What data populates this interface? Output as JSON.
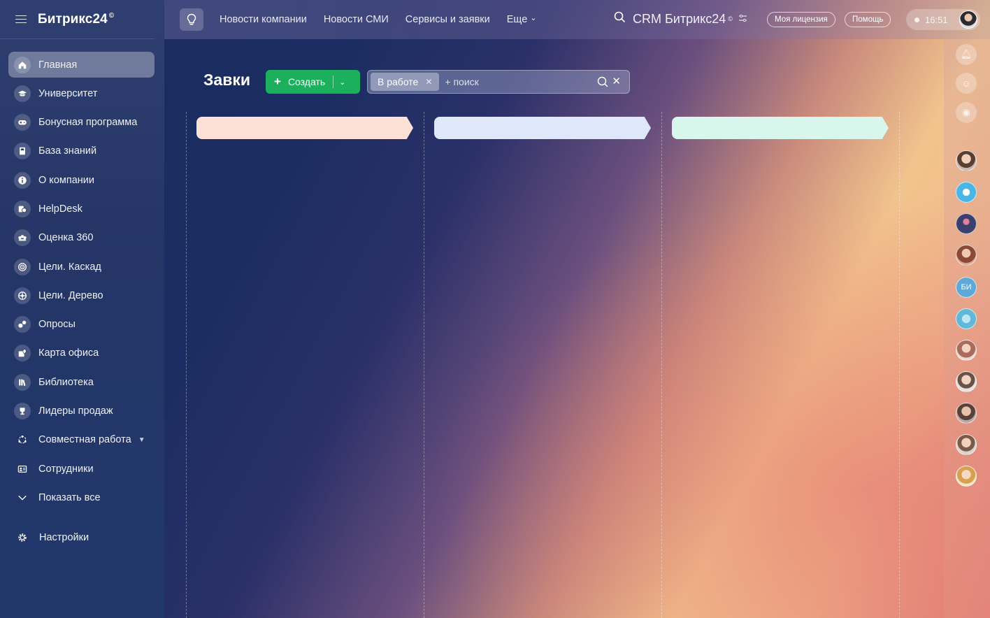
{
  "app": {
    "logo": "Битрикс24",
    "logo_mark": "©"
  },
  "sidebar": {
    "items": [
      {
        "label": "Главная",
        "icon": "home-icon"
      },
      {
        "label": "Университет",
        "icon": "graduation-cap-icon"
      },
      {
        "label": "Бонусная программа",
        "icon": "gamepad-icon"
      },
      {
        "label": "База знаний",
        "icon": "book-icon"
      },
      {
        "label": "О компании",
        "icon": "info-icon"
      },
      {
        "label": "HelpDesk",
        "icon": "helpdesk-icon"
      },
      {
        "label": "Оценка 360",
        "icon": "rating-icon"
      },
      {
        "label": "Цели. Каскад",
        "icon": "target-icon"
      },
      {
        "label": "Цели. Дерево",
        "icon": "tree-target-icon"
      },
      {
        "label": "Опросы",
        "icon": "poll-icon"
      },
      {
        "label": "Карта офиса",
        "icon": "map-icon"
      },
      {
        "label": "Библиотека",
        "icon": "library-icon"
      },
      {
        "label": "Лидеры продаж",
        "icon": "trophy-icon"
      },
      {
        "label": "Совместная работа",
        "icon": "collab-icon"
      },
      {
        "label": "Сотрудники",
        "icon": "employees-icon"
      },
      {
        "label": "Показать все",
        "icon": "chevron-down-icon"
      }
    ],
    "settings": "Настройки"
  },
  "topbar": {
    "nav": [
      "Новости компании",
      "Новости СМИ",
      "Сервисы и заявки",
      "Еще"
    ],
    "crm_title": "CRM Битрикс24",
    "crm_mark": "©",
    "license_button": "Моя лицензия",
    "help_button": "Помощь",
    "time": "16:51"
  },
  "page": {
    "title": "Завки",
    "create_button": "Создать",
    "filter_tag": "В работе",
    "search_placeholder": "+ поиск"
  },
  "rail": {
    "bi_label": "БИ"
  },
  "colors": {
    "accent_green": "#1bb05c",
    "stage_1": "#fde0d6",
    "stage_2": "#dfe8fb",
    "stage_3": "#d9f6ec"
  }
}
